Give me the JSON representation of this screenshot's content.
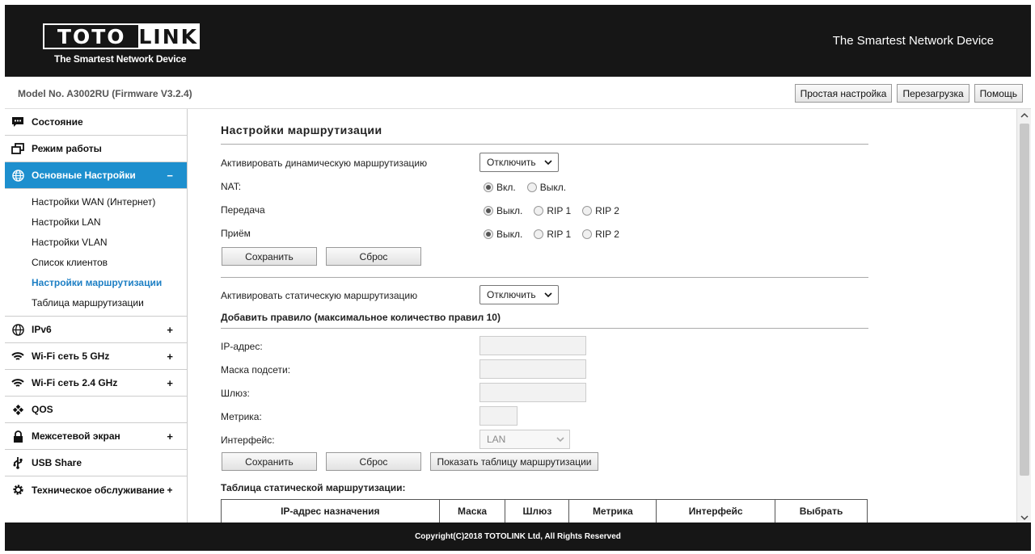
{
  "header": {
    "logo_left": "TOTO",
    "logo_right": "LINK",
    "logo_tagline": "The Smartest Network Device",
    "slogan": "The Smartest Network Device"
  },
  "subbar": {
    "model": "Model No. A3002RU (Firmware V3.2.4)",
    "buttons": [
      "Простая настройка",
      "Перезагрузка",
      "Помощь"
    ]
  },
  "sidebar": {
    "items": [
      {
        "label": "Состояние",
        "icon": "chat-icon"
      },
      {
        "label": "Режим работы",
        "icon": "windows-icon"
      },
      {
        "label": "Основные Настройки",
        "icon": "globe-icon",
        "toggle": "−"
      },
      {
        "label": "IPv6",
        "icon": "globe-icon",
        "toggle": "+"
      },
      {
        "label": "Wi-Fi сеть 5 GHz",
        "icon": "wifi-icon",
        "toggle": "+"
      },
      {
        "label": "Wi-Fi сеть 2.4 GHz",
        "icon": "wifi-icon",
        "toggle": "+"
      },
      {
        "label": "QOS",
        "icon": "qos-icon"
      },
      {
        "label": "Межсетевой экран",
        "icon": "lock-icon",
        "toggle": "+"
      },
      {
        "label": "USB Share",
        "icon": "usb-icon"
      },
      {
        "label": "Техническое обслуживание",
        "icon": "gear-icon",
        "toggle": "+"
      }
    ],
    "subitems": [
      "Настройки WAN (Интернет)",
      "Настройки LAN",
      "Настройки VLAN",
      "Список клиентов",
      "Настройки маршрутизации",
      "Таблица маршрутизации"
    ]
  },
  "main": {
    "title": "Настройки маршрутизации",
    "dynamic": {
      "label": "Активировать динамическую маршрутизацию",
      "value": "Отключить"
    },
    "nat": {
      "label": "NAT:",
      "opt_on": "Вкл.",
      "opt_off": "Выкл."
    },
    "transmit": {
      "label": "Передача",
      "opt_off": "Выкл.",
      "opt_rip1": "RIP 1",
      "opt_rip2": "RIP 2"
    },
    "receive": {
      "label": "Приём",
      "opt_off": "Выкл.",
      "opt_rip1": "RIP 1",
      "opt_rip2": "RIP 2"
    },
    "save": "Сохранить",
    "reset": "Сброс",
    "static": {
      "label": "Активировать статическую маршрутизацию",
      "value": "Отключить"
    },
    "add_rule": "Добавить правило (максимальное количество правил 10)",
    "fields": {
      "ip": "IP-адрес:",
      "mask": "Маска подсети:",
      "gateway": "Шлюз:",
      "metric": "Метрика:",
      "interface": "Интерфейс:",
      "interface_value": "LAN"
    },
    "show_table": "Показать таблицу маршрутизации",
    "table_title": "Таблица статической маршрутизации:",
    "table_headers": [
      "IP-адрес назначения",
      "Маска",
      "Шлюз",
      "Метрика",
      "Интерфейс",
      "Выбрать"
    ]
  },
  "footer": {
    "copyright": "Copyright(C)2018 TOTOLINK Ltd, All Rights Reserved"
  },
  "colors": {
    "header_bg": "#161616",
    "accent": "#1d8fce",
    "active_link": "#1d7fc4"
  }
}
